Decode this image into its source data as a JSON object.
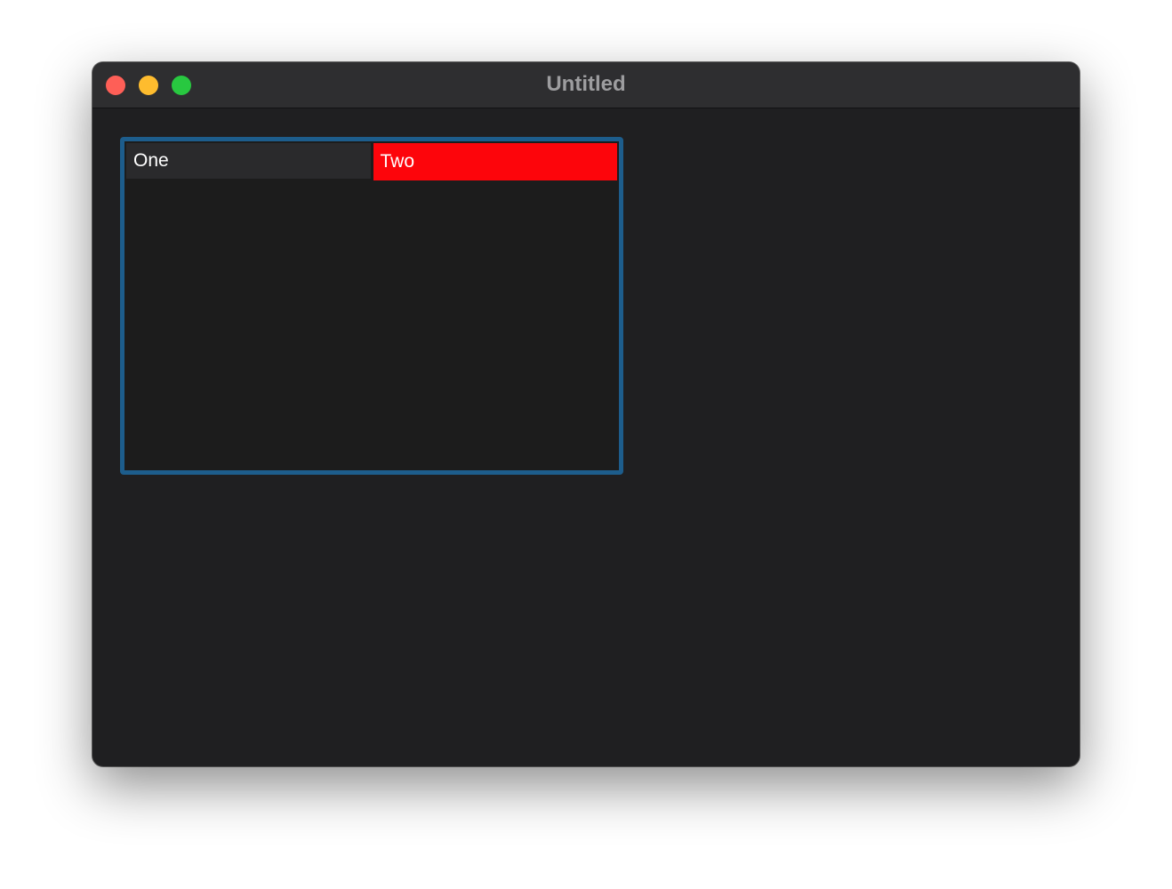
{
  "window": {
    "title": "Untitled",
    "traffic_lights": {
      "close_color": "#fe5f57",
      "minimize_color": "#febc2e",
      "zoom_color": "#28c840"
    }
  },
  "tabview": {
    "border_color": "#1d5d8c",
    "tabs": [
      {
        "label": "One",
        "selected": false
      },
      {
        "label": "Two",
        "selected": true,
        "background": "#fd050b"
      }
    ]
  }
}
